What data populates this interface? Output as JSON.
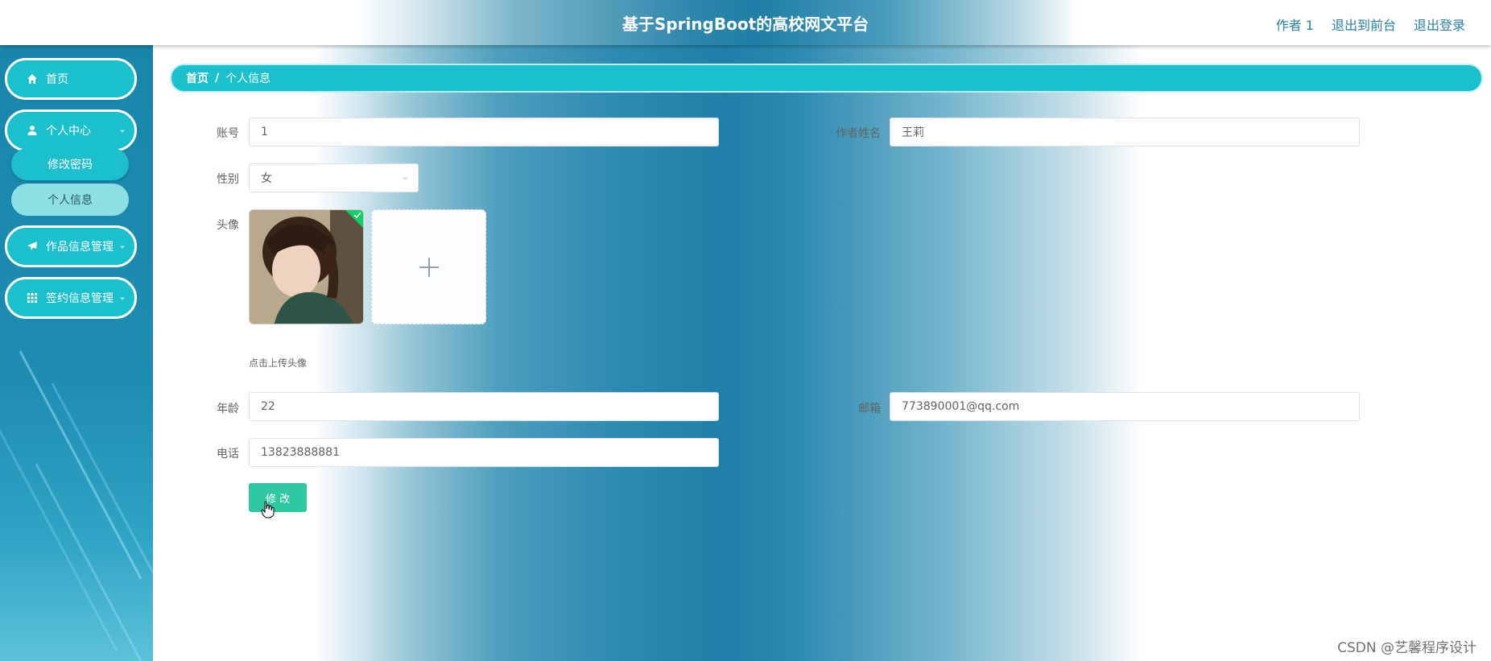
{
  "header": {
    "title": "基于SpringBoot的高校网文平台",
    "links": [
      "作者 1",
      "退出到前台",
      "退出登录"
    ]
  },
  "sidebar": {
    "items": [
      {
        "label": "首页",
        "icon": "home-icon"
      },
      {
        "label": "个人中心",
        "icon": "user-icon",
        "expanded": true
      },
      {
        "label": "作品信息管理",
        "icon": "send-icon"
      },
      {
        "label": "签约信息管理",
        "icon": "grid-icon"
      }
    ],
    "submenu": [
      "修改密码",
      "个人信息"
    ],
    "active_submenu": "个人信息"
  },
  "breadcrumb": {
    "home": "首页",
    "separator": "/",
    "current": "个人信息"
  },
  "form": {
    "account_label": "账号",
    "account_value": "1",
    "name_label": "作者姓名",
    "name_value": "王莉",
    "gender_label": "性别",
    "gender_value": "女",
    "avatar_label": "头像",
    "upload_tip": "点击上传头像",
    "age_label": "年龄",
    "age_value": "22",
    "email_label": "邮箱",
    "email_value": "773890001@qq.com",
    "phone_label": "电话",
    "phone_value": "13823888881",
    "submit_label": "修 改"
  },
  "watermark": "CSDN @艺馨程序设计",
  "colors": {
    "accent": "#1cbfcc",
    "submit": "#30c7a3",
    "header_link": "#2c7fa3"
  }
}
